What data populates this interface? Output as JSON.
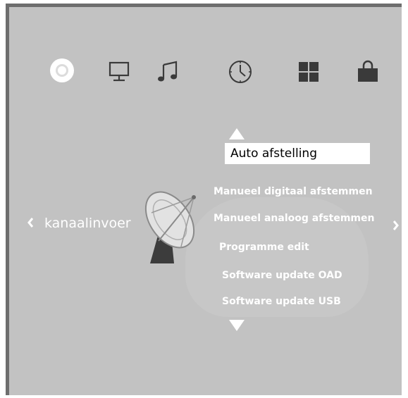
{
  "top_icons": [
    {
      "name": "disc-icon",
      "active": true
    },
    {
      "name": "monitor-icon",
      "active": false
    },
    {
      "name": "music-icon",
      "active": false
    },
    {
      "name": "clock-icon",
      "active": false
    },
    {
      "name": "apps-icon",
      "active": false
    },
    {
      "name": "lock-icon",
      "active": false
    }
  ],
  "category": {
    "label": "kanaalinvoer",
    "icon": "satellite-dish-icon",
    "prev_icon": "chevron-left-icon",
    "next_icon": "chevron-right-icon"
  },
  "menu": {
    "selected": "Auto afstelling",
    "items": [
      "Manueel digitaal afstemmen",
      "Manueel analoog afstemmen",
      "Programme edit",
      "Software update OAD",
      "Software update USB"
    ],
    "scroll_up_icon": "triangle-up-icon",
    "scroll_down_icon": "triangle-down-icon"
  },
  "colors": {
    "background": "#c2c2c2",
    "frame": "#6e6e6e",
    "text": "#ffffff",
    "highlight_bg": "#ffffff",
    "highlight_text": "#000000",
    "icon": "#3a3a3a"
  }
}
